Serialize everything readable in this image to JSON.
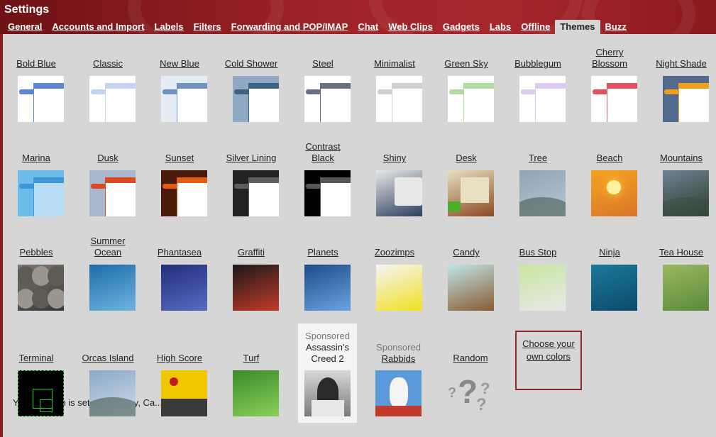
{
  "header": {
    "title": "Settings"
  },
  "tabs": [
    {
      "label": "General"
    },
    {
      "label": "Accounts and Import"
    },
    {
      "label": "Labels"
    },
    {
      "label": "Filters"
    },
    {
      "label": "Forwarding and POP/IMAP"
    },
    {
      "label": "Chat"
    },
    {
      "label": "Web Clips"
    },
    {
      "label": "Gadgets"
    },
    {
      "label": "Labs"
    },
    {
      "label": "Offline"
    },
    {
      "label": "Themes"
    },
    {
      "label": "Buzz"
    }
  ],
  "themes": {
    "row1": [
      {
        "name": "Bold Blue",
        "colors": [
          "#5a86d4",
          "#5a86d4"
        ]
      },
      {
        "name": "Classic",
        "colors": [
          "#c3d4f0",
          "#c3d4f0"
        ]
      },
      {
        "name": "New Blue",
        "colors": [
          "#7292bd",
          "#e6ecf4"
        ]
      },
      {
        "name": "Cold Shower",
        "colors": [
          "#3f6184",
          "#8fa9c4"
        ]
      },
      {
        "name": "Steel",
        "colors": [
          "#677183",
          "#5d6677"
        ]
      },
      {
        "name": "Minimalist",
        "colors": [
          "#d0d0d0",
          "#d0d0d0"
        ]
      },
      {
        "name": "Green Sky",
        "colors": [
          "#b0dca0",
          "#b0dca0"
        ]
      },
      {
        "name": "Bubblegum",
        "colors": [
          "#dccbf0",
          "#dccbf0"
        ]
      },
      {
        "name": "Cherry Blossom",
        "colors": [
          "#e0525d",
          "#e0525d"
        ]
      },
      {
        "name": "Night Shade",
        "colors": [
          "#f39f16",
          "#52698e"
        ]
      }
    ],
    "row2": [
      {
        "name": "Marina",
        "colors": [
          "#3d96da",
          "#6cbbe8"
        ]
      },
      {
        "name": "Dusk",
        "colors": [
          "#d94a1e",
          "#a9b7cd"
        ]
      },
      {
        "name": "Sunset",
        "colors": [
          "#e25d12",
          "#4a1a0a"
        ]
      },
      {
        "name": "Silver Lining",
        "colors": [
          "#5d5d5d",
          "#222222"
        ]
      },
      {
        "name": "Contrast Black",
        "colors": [
          "#555555",
          "#000000"
        ]
      },
      {
        "name": "Shiny",
        "colors": [
          "#e8e8e8",
          "#2d3e5e"
        ]
      },
      {
        "name": "Desk",
        "colors": [
          "#e8e0c0",
          "#8a4a22"
        ]
      },
      {
        "name": "Tree",
        "colors": [
          "#8ea5b5",
          "#b6c8d4"
        ]
      },
      {
        "name": "Beach",
        "colors": [
          "#f5a31e",
          "#d9762a"
        ]
      },
      {
        "name": "Mountains",
        "colors": [
          "#6f8294",
          "#2e3c2a"
        ]
      }
    ],
    "row3": [
      {
        "name": "Pebbles",
        "colors": [
          "#7a7873",
          "#3a3935"
        ]
      },
      {
        "name": "Summer Ocean",
        "colors": [
          "#1d6ca8",
          "#6fb4e0"
        ]
      },
      {
        "name": "Phantasea",
        "colors": [
          "#20307a",
          "#5a6ac0"
        ]
      },
      {
        "name": "Graffiti",
        "colors": [
          "#1a1a1a",
          "#c23a2a"
        ]
      },
      {
        "name": "Planets",
        "colors": [
          "#1e4a8a",
          "#6aa4e0"
        ]
      },
      {
        "name": "Zoozimps",
        "colors": [
          "#f5f5f5",
          "#f0e020"
        ]
      },
      {
        "name": "Candy",
        "colors": [
          "#bfe6e8",
          "#8a5a30"
        ]
      },
      {
        "name": "Bus Stop",
        "colors": [
          "#c8e6a0",
          "#e8e8e8"
        ]
      },
      {
        "name": "Ninja",
        "colors": [
          "#1a7a9a",
          "#0d4a6a"
        ]
      },
      {
        "name": "Tea House",
        "colors": [
          "#9ab860",
          "#5a8a3a"
        ]
      }
    ],
    "row4": [
      {
        "name": "Terminal",
        "colors": [
          "#000000",
          "#2ad02a"
        ]
      },
      {
        "name": "Orcas Island",
        "colors": [
          "#8aa8c8",
          "#d0dce8"
        ]
      },
      {
        "name": "High Score",
        "colors": [
          "#f0c800",
          "#3a3a3a"
        ]
      },
      {
        "name": "Turf",
        "colors": [
          "#3a8a2a",
          "#8ad05a"
        ]
      }
    ]
  },
  "sponsored": [
    {
      "tag": "Sponsored",
      "name": "Assassin's Creed 2"
    },
    {
      "tag": "Sponsored",
      "name": "Rabbids"
    }
  ],
  "random": {
    "name": "Random"
  },
  "custom": {
    "label": "Choose your own colors"
  },
  "footer": {
    "text": "Your location is set to Berkeley, Ca... Ch..."
  }
}
